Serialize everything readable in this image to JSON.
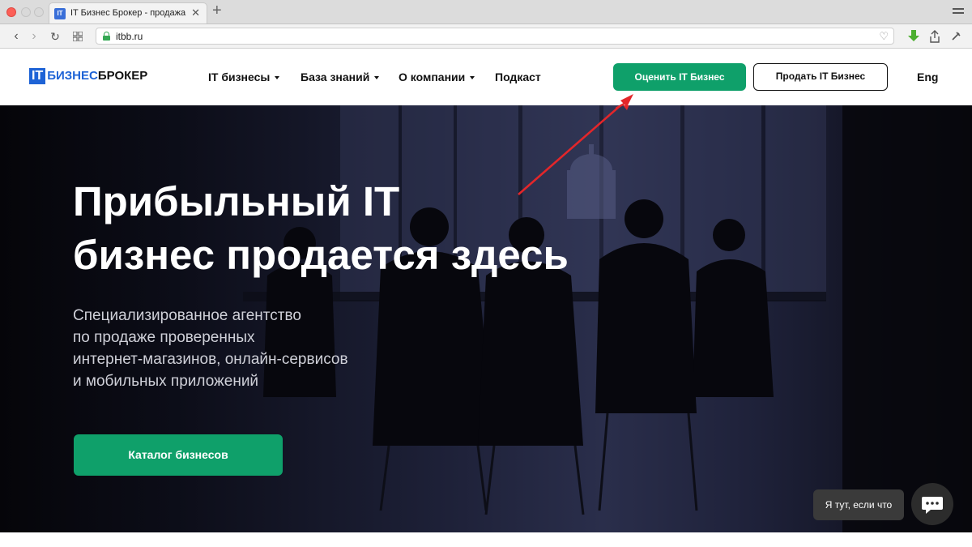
{
  "browser": {
    "tab_title": "IT Бизнес Брокер - продажа",
    "tab_favicon": "IT",
    "url": "itbb.ru"
  },
  "site": {
    "logo": {
      "it": "IT",
      "biz": "БИЗНЕС",
      "brok": "БРОКЕР"
    },
    "nav": [
      {
        "label": "IT бизнесы",
        "has_dropdown": true
      },
      {
        "label": "База знаний",
        "has_dropdown": true
      },
      {
        "label": "О компании",
        "has_dropdown": true
      },
      {
        "label": "Подкаст",
        "has_dropdown": false
      }
    ],
    "evaluate_button": "Оценить IT Бизнес",
    "sell_button": "Продать IT Бизнес",
    "language": "Eng"
  },
  "hero": {
    "title_line1": "Прибыльный IT",
    "title_line2": "бизнес продается здесь",
    "subtitle_lines": [
      "Специализированное агентство",
      "по продаже проверенных",
      "интернет-магазинов, онлайн-сервисов",
      "и мобильных приложений"
    ],
    "catalog_button": "Каталог бизнесов"
  },
  "chat": {
    "bubble_text": "Я тут, если что"
  },
  "colors": {
    "accent_green": "#0fa06a",
    "logo_blue": "#1e63d6",
    "arrow_red": "#e3262a"
  }
}
